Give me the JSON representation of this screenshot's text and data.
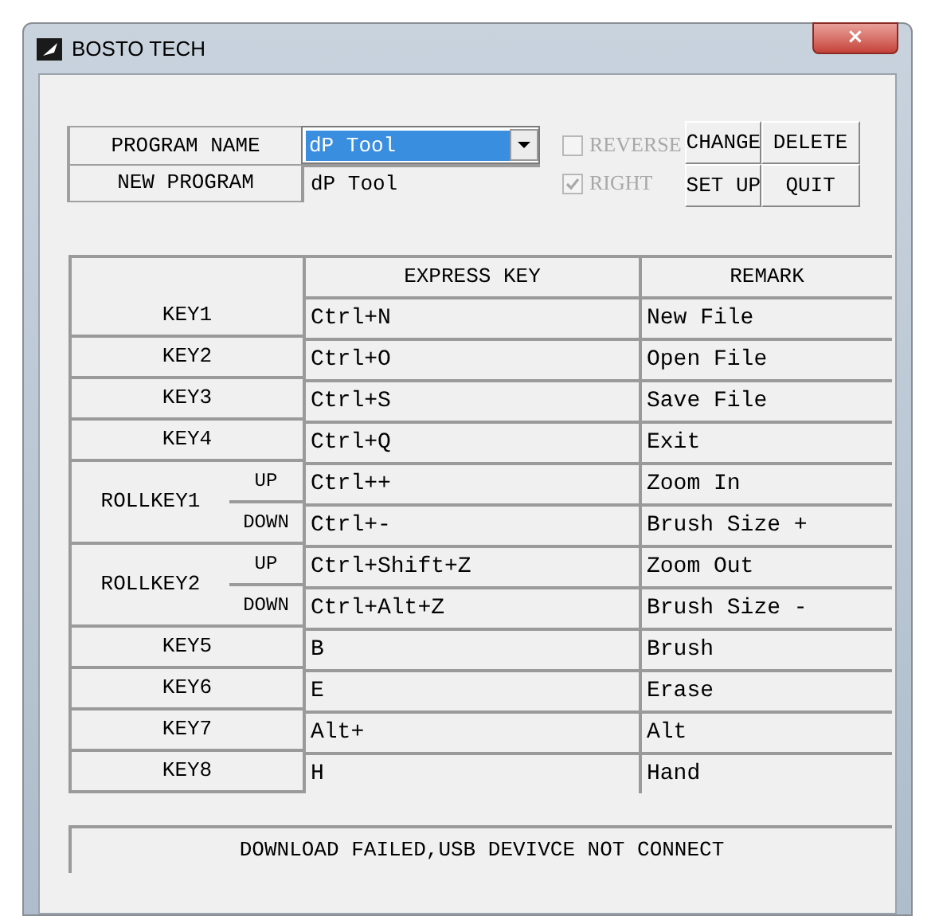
{
  "window": {
    "title": "BOSTO TECH",
    "close_button": "×"
  },
  "program": {
    "name_label": "PROGRAM NAME",
    "name_value": "dP Tool",
    "name_highlighted": true,
    "new_label": "NEW PROGRAM",
    "new_value": "dP Tool"
  },
  "options": [
    {
      "label": "REVERSE",
      "checked": false,
      "disabled": true
    },
    {
      "label": "RIGHT",
      "checked": true,
      "disabled": true
    }
  ],
  "buttons": [
    "CHANGE",
    "DELETE",
    "SET UP",
    "QUIT"
  ],
  "table": {
    "columns": [
      "EXPRESS KEY",
      "REMARK"
    ],
    "rows": [
      {
        "kind": "key",
        "key": "KEY1",
        "express": "Ctrl+N",
        "remark": "New File"
      },
      {
        "kind": "key",
        "key": "KEY2",
        "express": "Ctrl+O",
        "remark": "Open File"
      },
      {
        "kind": "key",
        "key": "KEY3",
        "express": "Ctrl+S",
        "remark": "Save File"
      },
      {
        "kind": "key",
        "key": "KEY4",
        "express": "Ctrl+Q",
        "remark": "Exit"
      },
      {
        "kind": "roll",
        "key": "ROLLKEY1",
        "directions": [
          {
            "label": "UP",
            "express": "Ctrl++",
            "remark": "Zoom In"
          },
          {
            "label": "DOWN",
            "express": "Ctrl+-",
            "remark": "Brush Size +"
          }
        ]
      },
      {
        "kind": "roll",
        "key": "ROLLKEY2",
        "directions": [
          {
            "label": "UP",
            "express": "Ctrl+Shift+Z",
            "remark": "Zoom Out"
          },
          {
            "label": "DOWN",
            "express": "Ctrl+Alt+Z",
            "remark": "Brush Size -"
          }
        ]
      },
      {
        "kind": "key",
        "key": "KEY5",
        "express": "B",
        "remark": "Brush"
      },
      {
        "kind": "key",
        "key": "KEY6",
        "express": "E",
        "remark": "Erase"
      },
      {
        "kind": "key",
        "key": "KEY7",
        "express": "Alt+",
        "remark": "Alt"
      },
      {
        "kind": "key",
        "key": "KEY8",
        "express": "H",
        "remark": "Hand"
      }
    ]
  },
  "status_bar": "DOWNLOAD FAILED,USB DEVIVCE NOT CONNECT"
}
